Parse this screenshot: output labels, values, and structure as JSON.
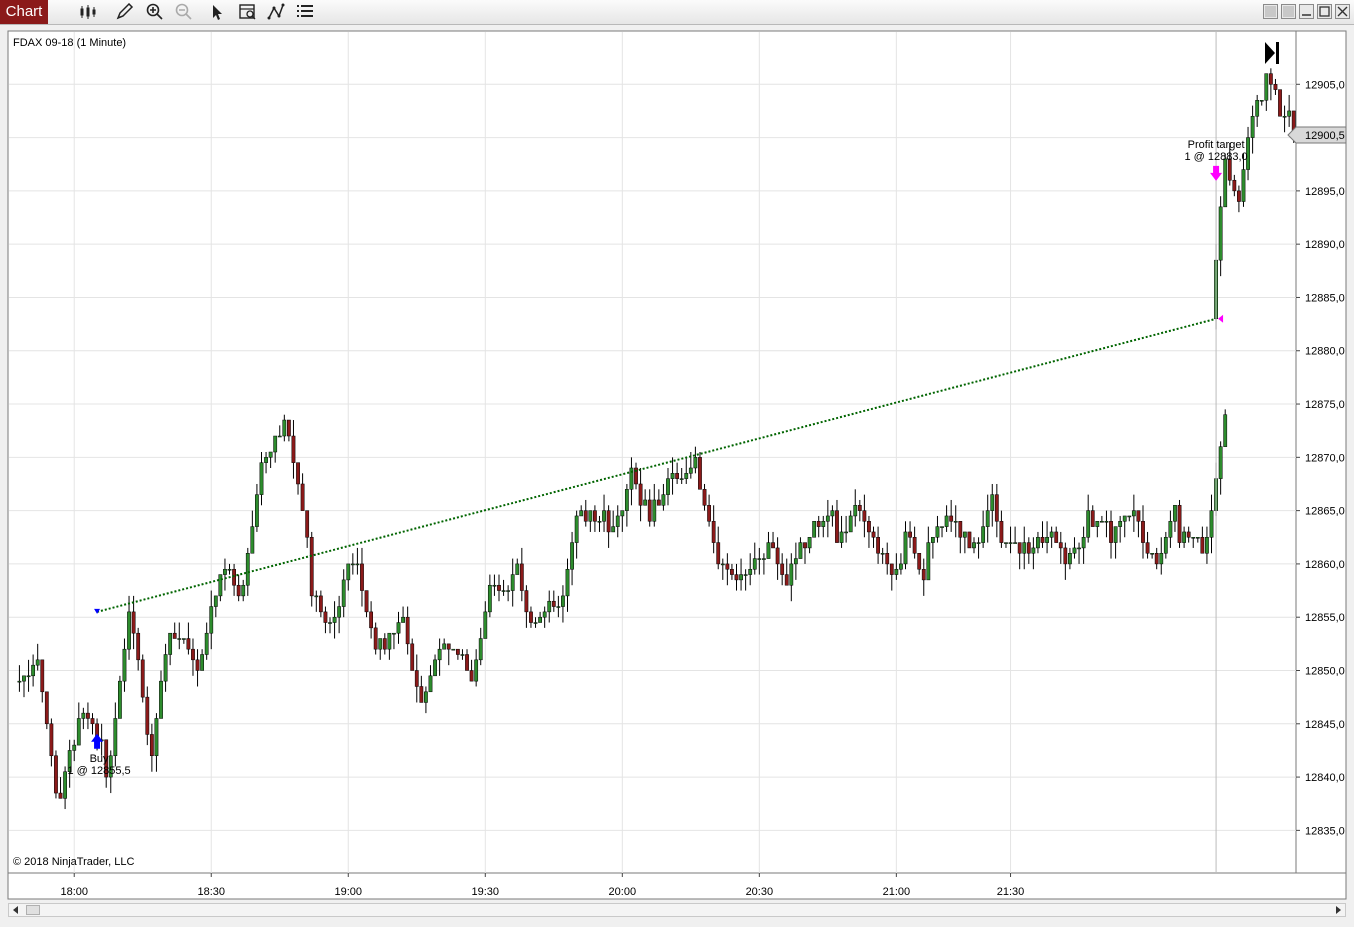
{
  "toolbar": {
    "chart_tab_label": "Chart",
    "icons": [
      "bar-type-icon",
      "pencil-icon",
      "zoom-in-icon",
      "zoom-out-icon",
      "pointer-icon",
      "data-box-icon",
      "drawing-tools-icon",
      "properties-icon"
    ]
  },
  "window_buttons": [
    "tile-icon",
    "tile-icon-2",
    "minimize-icon",
    "maximize-icon",
    "close-icon"
  ],
  "chart_data": {
    "type": "candlestick",
    "title": "FDAX 09-18 (1 Minute)",
    "copyright": "© 2018 NinjaTrader, LLC",
    "ylim": [
      12831.0,
      12910.0
    ],
    "y_ticks": [
      "12835,0",
      "12840,0",
      "12845,0",
      "12850,0",
      "12855,0",
      "12860,0",
      "12865,0",
      "12870,0",
      "12875,0",
      "12880,0",
      "12885,0",
      "12890,0",
      "12895,0",
      "12900,0",
      "12905,0"
    ],
    "x_ticks": [
      {
        "label": "18:00",
        "bar": 12
      },
      {
        "label": "18:30",
        "bar": 42
      },
      {
        "label": "19:00",
        "bar": 72
      },
      {
        "label": "19:30",
        "bar": 102
      },
      {
        "label": "20:00",
        "bar": 132
      },
      {
        "label": "20:30",
        "bar": 162
      },
      {
        "label": "21:00",
        "bar": 192
      },
      {
        "label": "21:30",
        "bar": 217
      }
    ],
    "x_range_bars": [
      -2.5,
      279.5
    ],
    "last_price": "12900,5",
    "colors": {
      "up": "#2d8c2d",
      "down": "#8b1a1a",
      "wick": "#000000",
      "buy": "#0000ff",
      "sell": "#ff00ff",
      "trade_line": "#006400",
      "grid": "#e4e4e4"
    },
    "trades": [
      {
        "label_line1": "Buy",
        "label_line2": "1 @ 12855,5",
        "bar": 17,
        "price": 12855.5,
        "side": "entry"
      },
      {
        "label_line1": "Profit target",
        "label_line2": "1 @ 12883,0",
        "bar": 262,
        "price": 12883.0,
        "side": "exit"
      }
    ],
    "segments": [
      {
        "from_bar": 0,
        "start": 12849.0,
        "targets": [
          12851.0,
          12838.0,
          12846.0,
          12840.0,
          12855.5,
          12842.0,
          12853.0,
          12850.0,
          12859.0,
          12858.0,
          12870.0,
          12872.0,
          12857.0,
          12855.0,
          12860.0,
          12853.0,
          12855.0,
          12848.0,
          12852.0,
          12849.0,
          12858.0,
          12860.0,
          12855.0,
          12857.0,
          12864.0,
          12863.0,
          12869.0,
          12866.0,
          12868.0,
          12867.0,
          12860.0,
          12859.0,
          12862.0,
          12860.0,
          12864.0,
          12862.0,
          12865.0,
          12861.0,
          12863.0,
          12862.0,
          12864.0,
          12862.0,
          12864.0,
          12861.0,
          12862.0,
          12860.0,
          12865.0,
          12862.0,
          12865.0,
          12860.0,
          12862.0,
          12861.0,
          12874.0
        ]
      },
      {
        "from_bar": 262,
        "start": 12883.0,
        "targets": [
          12898.0,
          12894.0,
          12902.0,
          12906.0,
          12902.0,
          12900.5
        ]
      }
    ]
  }
}
